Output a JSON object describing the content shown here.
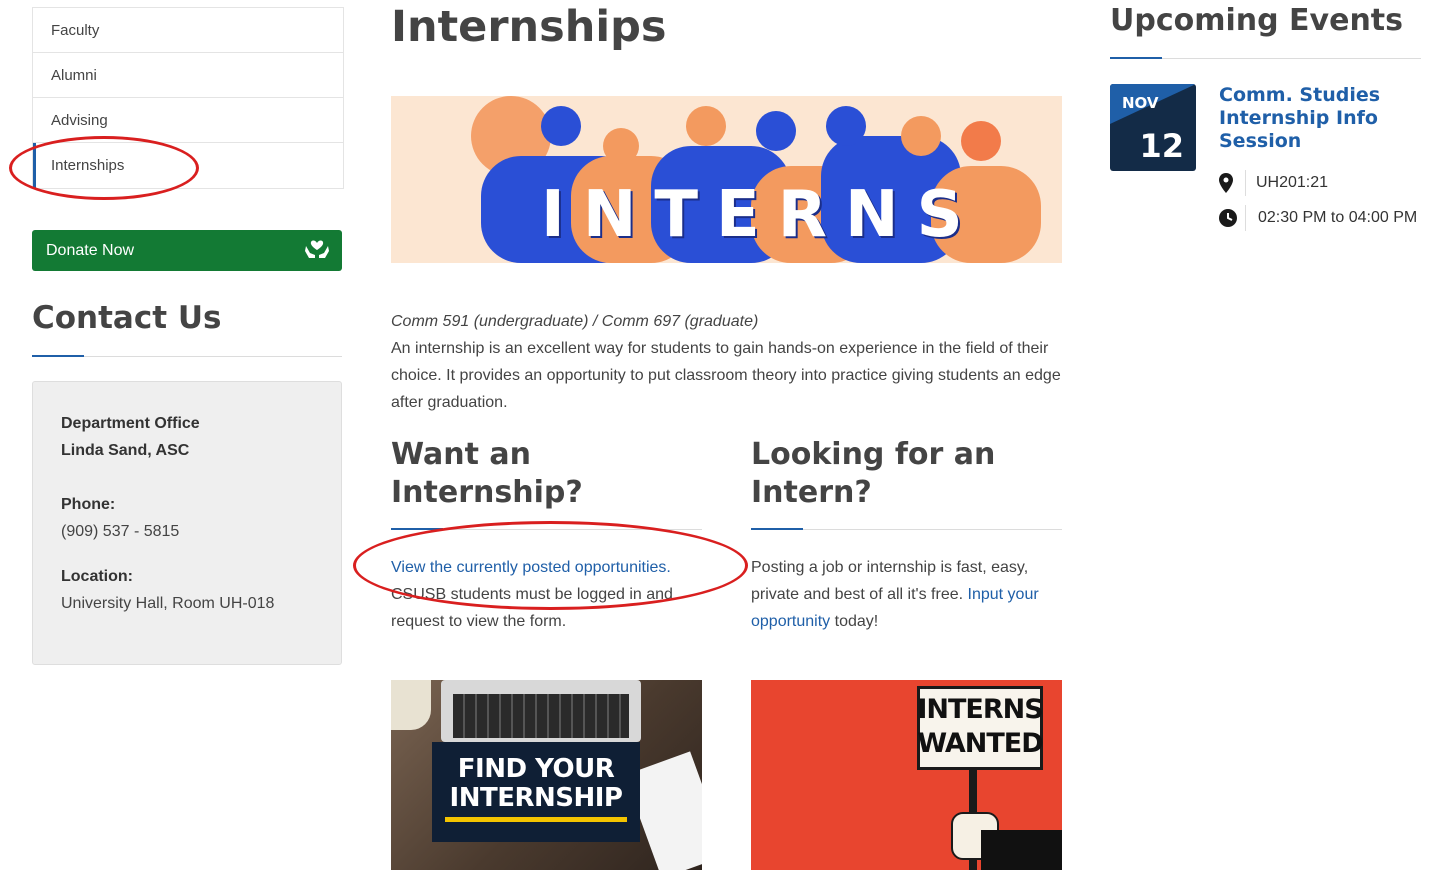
{
  "sidebar": {
    "nav": [
      {
        "label": "Faculty"
      },
      {
        "label": "Alumni"
      },
      {
        "label": "Advising"
      },
      {
        "label": "Internships"
      }
    ],
    "donate_label": "Donate Now",
    "contact_title": "Contact Us",
    "contact": {
      "dept": "Department Office",
      "person": "Linda Sand, ASC",
      "phone_label": "Phone:",
      "phone": "(909) 537 - 5815",
      "location_label": "Location:",
      "location": "University Hall, Room UH-018"
    }
  },
  "main": {
    "title": "Internships",
    "banner_letters": "INTERNS",
    "course": "Comm 591 (undergraduate) / Comm 697 (graduate)",
    "intro": "An internship is an excellent way for students to gain hands-on experience in the field of their choice. It provides an opportunity to put classroom theory into practice giving students an edge after graduation.",
    "col1": {
      "title_line1": "Want an",
      "title_line2": "Internship?",
      "link": "View the currently posted opportunities.",
      "text": "CSUSB students must be logged in and request to view the form.",
      "image_text1": "FIND YOUR",
      "image_text2": "INTERNSHIP"
    },
    "col2": {
      "title_line1": "Looking for an",
      "title_line2": "Intern?",
      "text_before": "Posting a job or internship is fast, easy, private and best of all it's free.",
      "link": "Input your opportunity",
      "text_after": "today!",
      "image_text1": "INTERNS",
      "image_text2": "WANTED"
    }
  },
  "events": {
    "title": "Upcoming Events",
    "items": [
      {
        "month": "NOV",
        "day": "12",
        "title": "Comm. Studies Internship Info Session",
        "location": "UH201:21",
        "time": "02:30 PM to 04:00 PM"
      }
    ]
  },
  "colors": {
    "accent": "#1f5fa8",
    "donate": "#137a34",
    "annotation": "#d91f1f",
    "badge": "#132b47"
  },
  "icons": [
    "heart-hands-icon",
    "map-pin-icon",
    "clock-icon"
  ]
}
